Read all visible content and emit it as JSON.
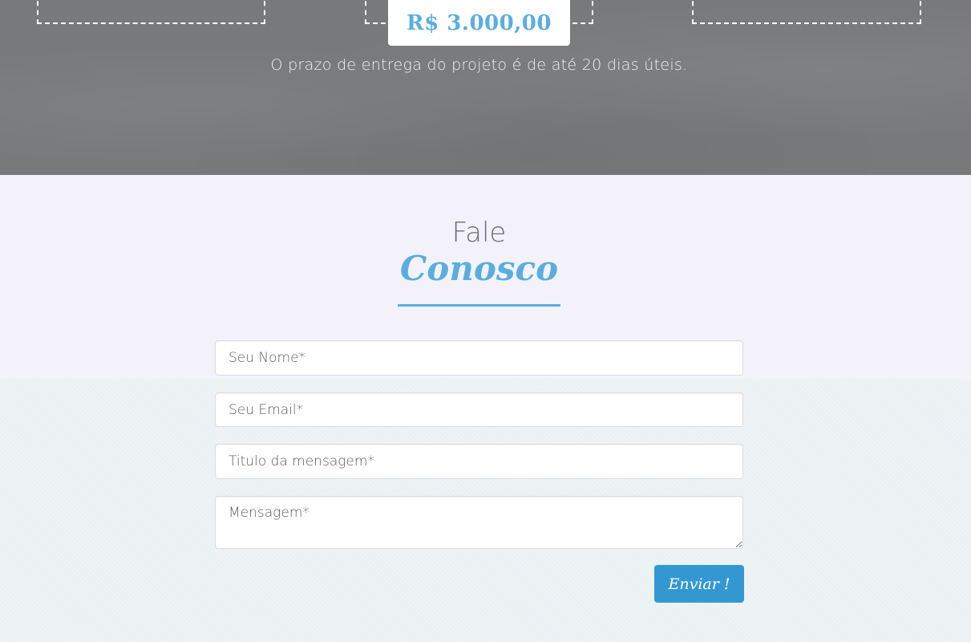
{
  "pricing": {
    "price": "R$ 3.000,00",
    "delivery_note": "O prazo de entrega do projeto é de até 20 dias úteis."
  },
  "contact": {
    "heading_line1": "Fale",
    "heading_line2": "Conosco",
    "form": {
      "name_placeholder": "Seu Nome*",
      "email_placeholder": "Seu Email*",
      "title_placeholder": "Titulo da mensagem*",
      "message_placeholder": "Mensagem*",
      "submit_label": "Enviar !"
    }
  },
  "colors": {
    "accent": "#5aaedf",
    "button": "#3398d2",
    "pricing_bg": "#78797b",
    "contact_bg": "#f3f2fb"
  }
}
